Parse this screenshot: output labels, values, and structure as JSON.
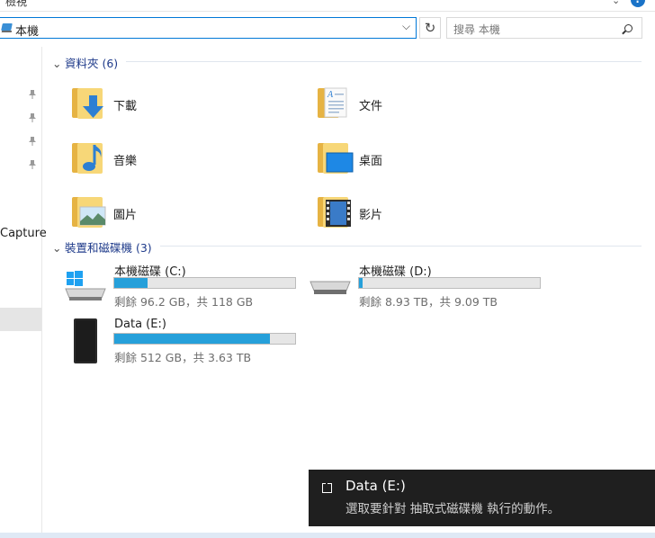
{
  "ribbon": {
    "tab_label": "檢視"
  },
  "address": {
    "path": "本機",
    "dropdown_icon": "chevron-down-icon"
  },
  "search": {
    "placeholder": "搜尋 本機"
  },
  "nav": {
    "truncated_item": "Capture"
  },
  "folders_group": {
    "title": "資料夾 (6)",
    "items": [
      {
        "name": "下載",
        "icon": "downloads-folder-icon"
      },
      {
        "name": "文件",
        "icon": "documents-folder-icon"
      },
      {
        "name": "音樂",
        "icon": "music-folder-icon"
      },
      {
        "name": "桌面",
        "icon": "desktop-folder-icon"
      },
      {
        "name": "圖片",
        "icon": "pictures-folder-icon"
      },
      {
        "name": "影片",
        "icon": "videos-folder-icon"
      }
    ]
  },
  "drives_group": {
    "title": "裝置和磁碟機 (3)",
    "items": [
      {
        "name": "本機磁碟 (C:)",
        "free_text": "剩餘 96.2 GB，共 118 GB",
        "used_fraction": 0.185,
        "icon": "windows-drive-icon"
      },
      {
        "name": "本機磁碟 (D:)",
        "free_text": "剩餘 8.93 TB，共 9.09 TB",
        "used_fraction": 0.018,
        "icon": "hard-drive-icon"
      },
      {
        "name": "Data (E:)",
        "free_text": "剩餘 512 GB，共 3.63 TB",
        "used_fraction": 0.86,
        "icon": "external-drive-icon"
      }
    ]
  },
  "toast": {
    "title": "Data (E:)",
    "message": "選取要針對 抽取式磁碟機 執行的動作。"
  },
  "colors": {
    "accent": "#0078d7",
    "bar_fill": "#26a0da",
    "toast_bg": "#1f1f1f"
  }
}
